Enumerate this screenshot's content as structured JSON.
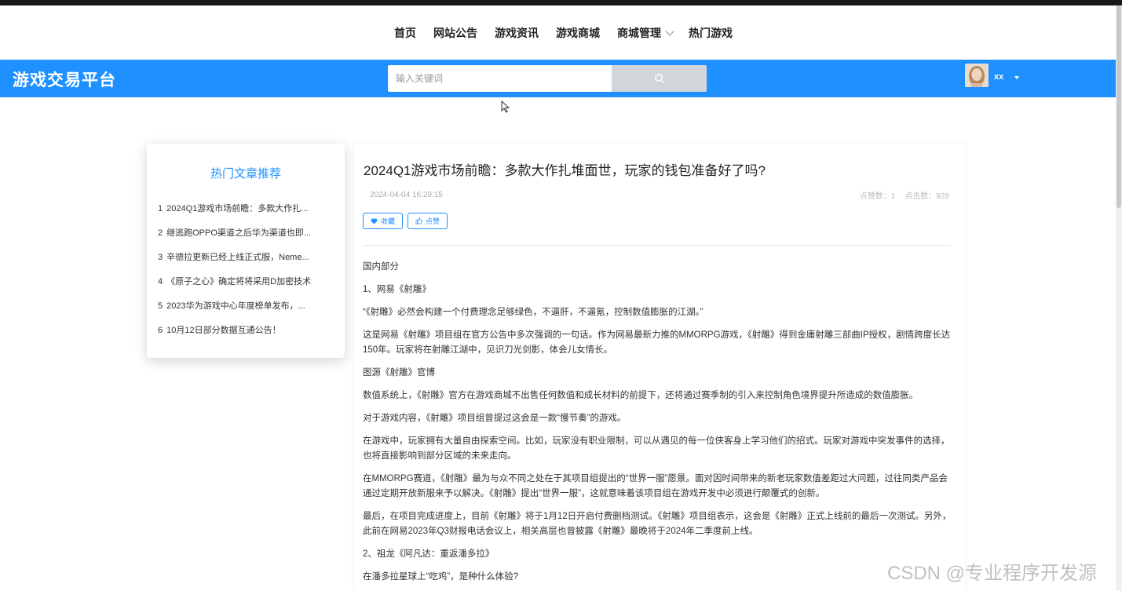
{
  "nav": {
    "items": [
      "首页",
      "网站公告",
      "游戏资讯",
      "游戏商城",
      "商城管理",
      "热门游戏"
    ]
  },
  "header": {
    "brand": "游戏交易平台",
    "search_placeholder": "输入关键词",
    "username": "xx"
  },
  "sidebar": {
    "title": "热门文章推荐",
    "items": [
      {
        "num": "1",
        "text": "2024Q1游戏市场前瞻：多款大作扎..."
      },
      {
        "num": "2",
        "text": "继逃跑OPPO渠道之后华为渠道也即..."
      },
      {
        "num": "3",
        "text": "辛德拉更新已经上线正式服，Neme..."
      },
      {
        "num": "4",
        "text": "《原子之心》确定将将采用D加密技术"
      },
      {
        "num": "5",
        "text": "2023华为游戏中心年度榜单发布，..."
      },
      {
        "num": "6",
        "text": "10月12日部分数据互通公告！"
      }
    ]
  },
  "article": {
    "title": "2024Q1游戏市场前瞻：多款大作扎堆面世，玩家的钱包准备好了吗?",
    "date": "2024-04-04 16:29:15",
    "likes": "点赞数：1",
    "views": "点击数：928",
    "favorite_label": "收藏",
    "like_label": "点赞",
    "paragraphs": [
      "国内部分",
      "1、网易《射雕》",
      "“《射雕》必然会构建一个付费理念足够绿色，不逼肝，不逼氪，控制数值膨胀的江湖。”",
      "这是网易《射雕》项目组在官方公告中多次强调的一句话。作为网易最新力推的MMORPG游戏，《射雕》得到金庸射雕三部曲IP授权，剧情跨度长达150年。玩家将在射雕江湖中，见识刀光剑影，体会儿女情长。",
      "图源《射雕》官博",
      "数值系统上，《射雕》官方在游戏商城不出售任何数值和成长材料的前提下，还将通过赛季制的引入来控制角色境界提升所造成的数值膨胀。",
      "对于游戏内容，《射雕》项目组曾提过这会是一款“慢节奏”的游戏。",
      "在游戏中，玩家拥有大量自由探索空间。比如，玩家没有职业限制，可以从遇见的每一位侠客身上学习他们的招式。玩家对游戏中突发事件的选择，也将直接影响到部分区域的未来走向。",
      "在MMORPG赛道，《射雕》最为与众不同之处在于其项目组提出的“世界一服”愿景。面对因时间带来的新老玩家数值差距过大问题，过往同类产品会通过定期开放新服来予以解决。《射雕》提出“世界一服”，这就意味着该项目组在游戏开发中必须进行颠覆式的创新。",
      "最后，在项目完成进度上，目前《射雕》将于1月12日开启付费删档测试。《射雕》项目组表示，这会是《射雕》正式上线前的最后一次测试。另外，此前在网易2023年Q3财报电话会议上，相关高层也曾披露《射雕》最晚将于2024年二季度前上线。",
      "2、祖龙《阿凡达：重返潘多拉》",
      "在潘多拉星球上“吃鸡”，是种什么体验?"
    ]
  },
  "watermark": "CSDN @专业程序开发源"
}
